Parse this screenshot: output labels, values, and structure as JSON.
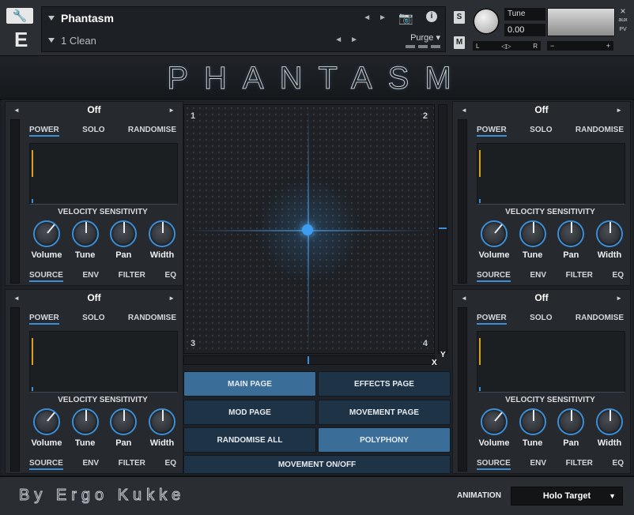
{
  "header": {
    "instrument_name": "Phantasm",
    "preset_name": "1 Clean",
    "purge_label": "Purge",
    "tune_label": "Tune",
    "tune_value": "0.00",
    "pan_left": "L",
    "pan_center": "◁▷",
    "pan_right": "R",
    "solo_label": "S",
    "mute_label": "M",
    "vol_minus": "−",
    "vol_plus": "+",
    "close_label": "×",
    "aux_label": "aux",
    "pv_label": "PV",
    "logo_letter": "E"
  },
  "title": "PHANTASM",
  "panels": [
    {
      "id": "top-left",
      "value": "Off"
    },
    {
      "id": "bottom-left",
      "value": "Off"
    },
    {
      "id": "top-right",
      "value": "Off"
    },
    {
      "id": "bottom-right",
      "value": "Off"
    }
  ],
  "panel_labels": {
    "power": "POWER",
    "solo": "SOLO",
    "randomise": "RANDOMISE",
    "velocity_sensitivity": "VELOCITY SENSITIVITY",
    "volume": "Volume",
    "tune": "Tune",
    "pan": "Pan",
    "width": "Width",
    "source": "SOURCE",
    "env": "ENV",
    "filter": "FILTER",
    "eq": "EQ",
    "arrow_left": "◄",
    "arrow_right": "►"
  },
  "xy_pad": {
    "corner_1": "1",
    "corner_2": "2",
    "corner_3": "3",
    "corner_4": "4",
    "x_label": "X",
    "y_label": "Y"
  },
  "buttons": {
    "main_page": "MAIN PAGE",
    "effects_page": "EFFECTS PAGE",
    "mod_page": "MOD PAGE",
    "movement_page": "MOVEMENT PAGE",
    "randomise_all": "RANDOMISE ALL",
    "polyphony": "POLYPHONY",
    "movement_onoff": "MOVEMENT ON/OFF"
  },
  "footer": {
    "byline": "By Ergo Kukke",
    "animation_label": "ANIMATION",
    "animation_value": "Holo Target"
  },
  "colors": {
    "accent_blue": "#3a8fd6",
    "button_on": "#3a6e99",
    "button_off": "#1f3347",
    "accent_amber": "#d8a020"
  }
}
